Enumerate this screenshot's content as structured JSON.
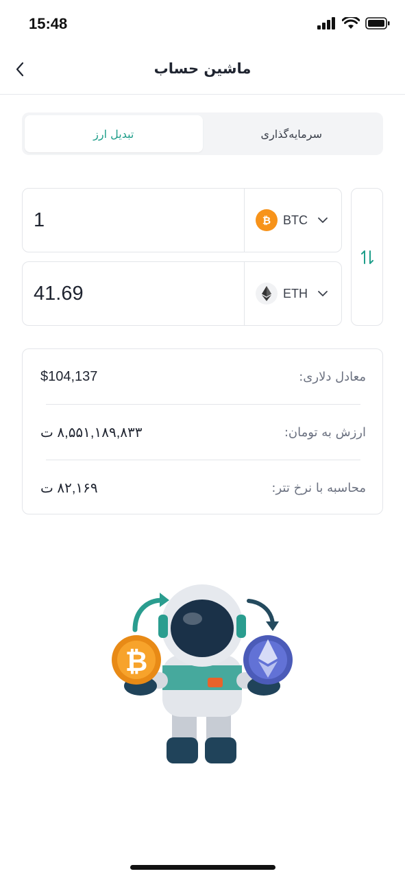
{
  "status_bar": {
    "time": "15:48"
  },
  "header": {
    "title": "ماشین حساب"
  },
  "tabs": [
    {
      "label": "سرمایه‌گذاری",
      "active": false
    },
    {
      "label": "تبدیل ارز",
      "active": true
    }
  ],
  "converter": {
    "from": {
      "amount": "1",
      "currency": "BTC",
      "icon": "bitcoin-icon"
    },
    "to": {
      "amount": "41.69",
      "currency": "ETH",
      "icon": "ethereum-icon"
    }
  },
  "info": {
    "usd_label": "معادل دلاری:",
    "usd_value": "$104,137",
    "toman_label": "ارزش به تومان:",
    "toman_value": "۸,۵۵۱,۱۸۹,۸۳۳ ت",
    "tether_label": "محاسبه با نرخ تتر:",
    "tether_value": "۸۲,۱۶۹ ت"
  },
  "colors": {
    "accent": "#1f9e8a",
    "bitcoin": "#f7931a",
    "ethereum": "#627eea"
  }
}
